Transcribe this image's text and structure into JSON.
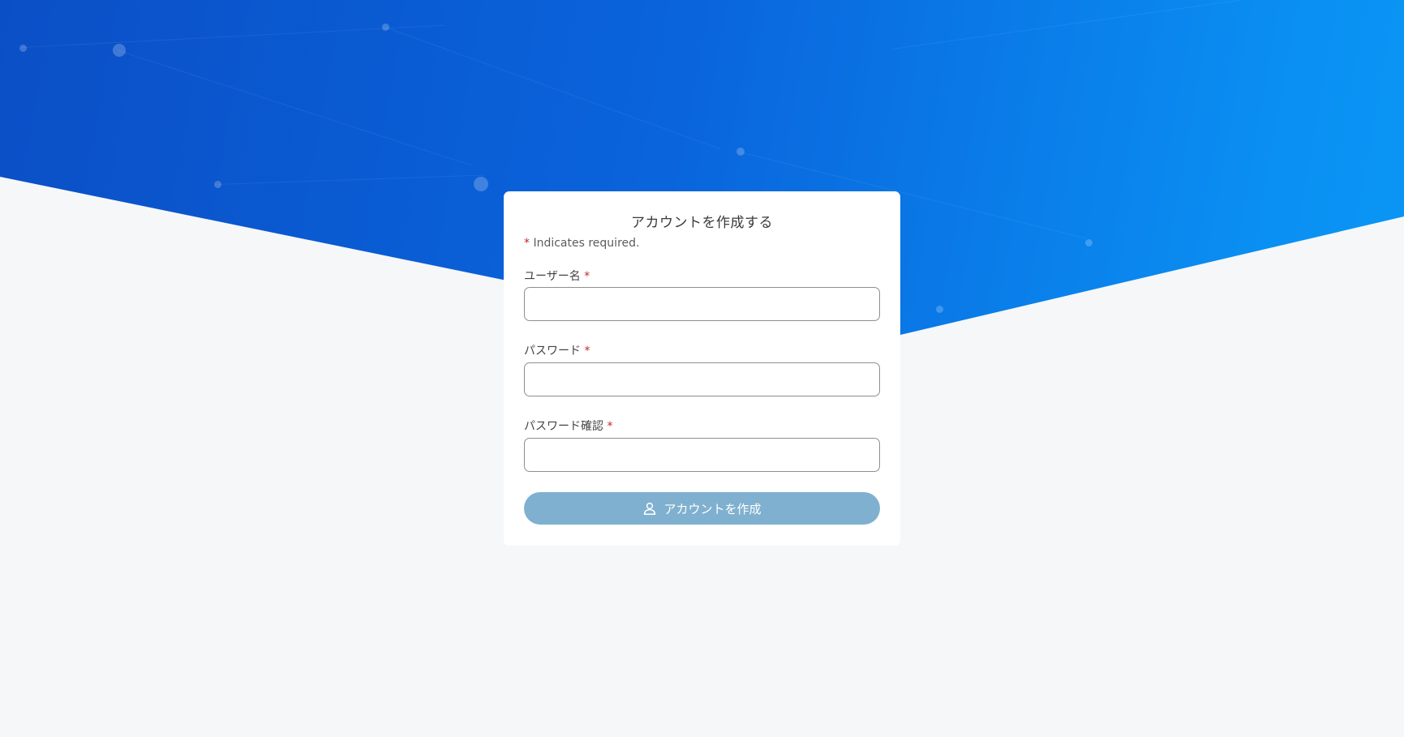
{
  "form": {
    "title": "アカウントを作成する",
    "required_marker": "*",
    "required_note": "Indicates required.",
    "fields": [
      {
        "label": "ユーザー名",
        "value": "",
        "placeholder": ""
      },
      {
        "label": "パスワード",
        "value": "",
        "placeholder": ""
      },
      {
        "label": "パスワード確認",
        "value": "",
        "placeholder": ""
      }
    ],
    "submit_label": "アカウントを作成",
    "submit_icon": "user-icon"
  },
  "colors": {
    "hero_gradient_start": "#0b4fc6",
    "hero_gradient_end": "#0a9af7",
    "background": "#f5f7f9",
    "required_star": "#c0292b",
    "button_bg": "#7fb0cf"
  }
}
